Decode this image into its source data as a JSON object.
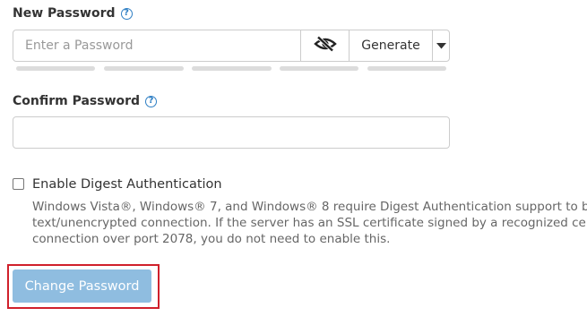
{
  "new_password": {
    "label": "New Password",
    "help_icon": "question-circle-icon",
    "placeholder": "Enter a Password",
    "visibility_icon": "eye-slash-icon",
    "generate_label": "Generate",
    "dropdown_icon": "caret-down-icon",
    "strength_meter_segments": 5
  },
  "confirm_password": {
    "label": "Confirm Password",
    "help_icon": "question-circle-icon",
    "value": ""
  },
  "digest": {
    "checkbox_label": "Enable Digest Authentication",
    "checked": false,
    "description_lines": [
      "Windows Vista®, Windows® 7, and Windows® 8 require Digest Authentication support to be e",
      "text/unencrypted connection. If the server has an SSL certificate signed by a recognized certifi",
      "connection over port 2078, you do not need to enable this."
    ]
  },
  "actions": {
    "change_password_label": "Change Password"
  },
  "colors": {
    "help_blue": "#2f7fc4",
    "button_disabled_blue": "#8fbde0",
    "highlight_red": "#d0202b",
    "border_gray": "#cccccc",
    "meter_gray": "#dcdcdc"
  }
}
